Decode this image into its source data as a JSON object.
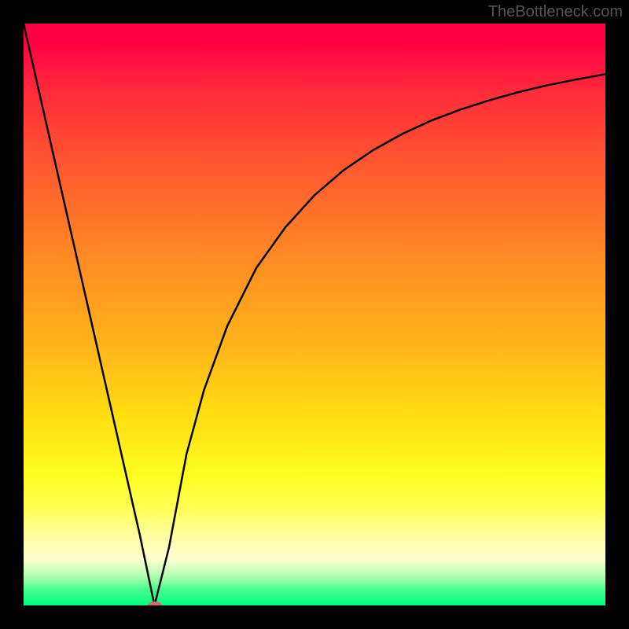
{
  "watermark": "TheBottleneck.com",
  "chart_data": {
    "type": "line",
    "title": "",
    "xlabel": "",
    "ylabel": "",
    "xlim": [
      0,
      100
    ],
    "ylim": [
      0,
      100
    ],
    "grid": false,
    "series": [
      {
        "name": "curve",
        "x": [
          0,
          5,
          10,
          15,
          20,
          22.5,
          25,
          28,
          31,
          35,
          40,
          45,
          50,
          55,
          60,
          65,
          70,
          75,
          80,
          85,
          90,
          95,
          100
        ],
        "values": [
          100,
          78,
          56,
          34,
          12,
          0,
          10,
          26,
          37,
          48,
          58,
          65,
          70.5,
          74.8,
          78.2,
          81,
          83.3,
          85.2,
          86.8,
          88.2,
          89.4,
          90.4,
          91.3
        ]
      }
    ],
    "marker": {
      "x": 22.5,
      "y": 0
    }
  },
  "colors": {
    "curve": "#000000",
    "marker": "#d46a6a",
    "frame": "#000000"
  }
}
